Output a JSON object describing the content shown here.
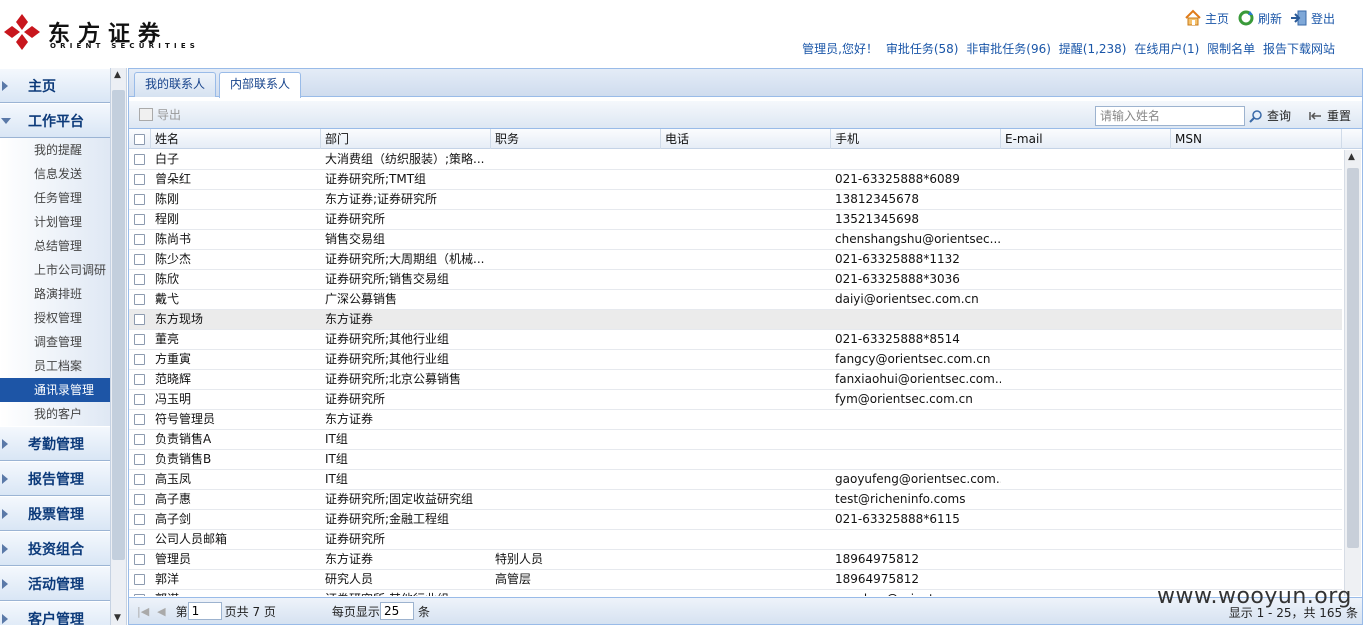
{
  "brand": {
    "name_cn": "东方证券",
    "name_en": "ORIENT SECURITIES",
    "color": "#c8161d"
  },
  "toplinks": [
    {
      "label": "主页",
      "icon": "home-icon"
    },
    {
      "label": "刷新",
      "icon": "refresh-icon"
    },
    {
      "label": "登出",
      "icon": "logout-icon"
    }
  ],
  "userbar": [
    "管理员,您好！",
    "审批任务(58)",
    "非审批任务(96)",
    "提醒(1,238)",
    "在线用户(1)",
    "限制名单",
    "报告下载网站"
  ],
  "sidebar": {
    "top": [
      {
        "label": "主页"
      },
      {
        "label": "工作平台"
      }
    ],
    "items": [
      "我的提醒",
      "信息发送",
      "任务管理",
      "计划管理",
      "总结管理",
      "上市公司调研",
      "路演排班",
      "授权管理",
      "调查管理",
      "员工档案",
      "通讯录管理",
      "我的客户"
    ],
    "active_item": "通讯录管理",
    "bottom": [
      "考勤管理",
      "报告管理",
      "股票管理",
      "投资组合",
      "活动管理",
      "客户管理"
    ]
  },
  "tabs": [
    {
      "label": "我的联系人"
    },
    {
      "label": "内部联系人"
    }
  ],
  "active_tab": "内部联系人",
  "toolbar": {
    "export_label": "导出",
    "search_placeholder": "请输入姓名",
    "query_label": "查询",
    "reset_label": "重置"
  },
  "grid": {
    "columns": [
      "姓名",
      "部门",
      "职务",
      "电话",
      "手机",
      "E-mail",
      "MSN"
    ],
    "rows": [
      [
        "白子",
        "大消费组（纺织服装）;策略...",
        "",
        "",
        "",
        "",
        ""
      ],
      [
        "曾朵红",
        "证券研究所;TMT组",
        "",
        "",
        "021-63325888*6089",
        "",
        ""
      ],
      [
        "陈刚",
        "东方证券;证券研究所",
        "",
        "",
        "13812345678",
        "",
        ""
      ],
      [
        "程刚",
        "证券研究所",
        "",
        "",
        "13521345698",
        "",
        ""
      ],
      [
        "陈尚书",
        "销售交易组",
        "",
        "",
        "chenshangshu@orientsec...",
        "",
        ""
      ],
      [
        "陈少杰",
        "证券研究所;大周期组（机械...",
        "",
        "",
        "021-63325888*1132",
        "",
        ""
      ],
      [
        "陈欣",
        "证券研究所;销售交易组",
        "",
        "",
        "021-63325888*3036",
        "",
        ""
      ],
      [
        "戴弋",
        "广深公募销售",
        "",
        "",
        "daiyi@orientsec.com.cn",
        "",
        ""
      ],
      [
        "东方现场",
        "东方证券",
        "",
        "",
        "",
        "",
        ""
      ],
      [
        "董亮",
        "证券研究所;其他行业组",
        "",
        "",
        "021-63325888*8514",
        "",
        ""
      ],
      [
        "方重寅",
        "证券研究所;其他行业组",
        "",
        "",
        "fangcy@orientsec.com.cn",
        "",
        ""
      ],
      [
        "范晓辉",
        "证券研究所;北京公募销售",
        "",
        "",
        "fanxiaohui@orientsec.com...",
        "",
        ""
      ],
      [
        "冯玉明",
        "证券研究所",
        "",
        "",
        "fym@orientsec.com.cn",
        "",
        ""
      ],
      [
        "符号管理员",
        "东方证券",
        "",
        "",
        "",
        "",
        ""
      ],
      [
        "负责销售A",
        "IT组",
        "",
        "",
        "",
        "",
        ""
      ],
      [
        "负责销售B",
        "IT组",
        "",
        "",
        "",
        "",
        ""
      ],
      [
        "高玉凤",
        "IT组",
        "",
        "",
        "gaoyufeng@orientsec.com...",
        "",
        ""
      ],
      [
        "高子惠",
        "证券研究所;固定收益研究组",
        "",
        "",
        "test@richeninfo.coms",
        "",
        ""
      ],
      [
        "高子剑",
        "证券研究所;金融工程组",
        "",
        "",
        "021-63325888*6115",
        "",
        ""
      ],
      [
        "公司人员邮箱",
        "证券研究所",
        "",
        "",
        "",
        "",
        ""
      ],
      [
        "管理员",
        "东方证券",
        "特别人员",
        "",
        "18964975812",
        "",
        ""
      ],
      [
        "郭洋",
        "研究人员",
        "高管层",
        "",
        "18964975812",
        "",
        ""
      ],
      [
        "郭谋",
        "证券研究所;其他行业组",
        "",
        "",
        "guozhan@orientsec.com.cn",
        "",
        ""
      ]
    ],
    "selected_row": 8
  },
  "pager": {
    "page_prefix": "第",
    "page_value": "1",
    "page_suffix": "页共 7 页",
    "size_prefix": "每页显示",
    "size_value": "25",
    "size_suffix": "条",
    "info": "显示 1 - 25，共 165 条"
  },
  "watermark": "www.wooyun.org"
}
